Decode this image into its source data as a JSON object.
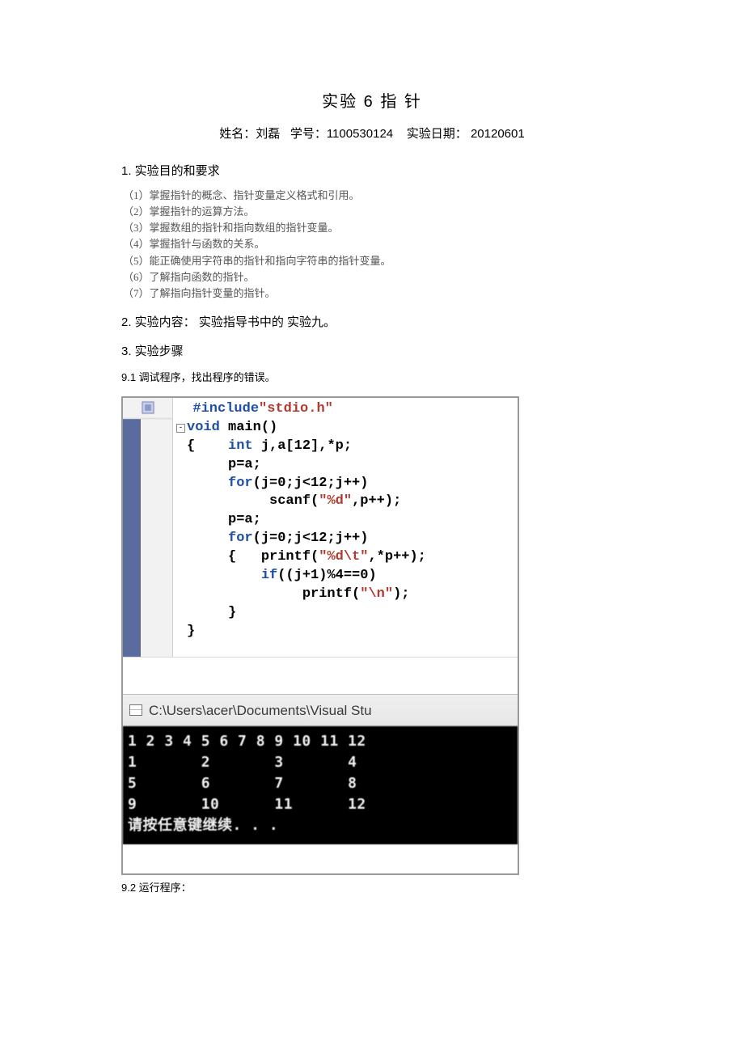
{
  "title": "实验 6   指  针",
  "student": {
    "name_label": "姓名：刘磊",
    "id_label": "学号：1100530124",
    "date_label": "实验日期： 20120601"
  },
  "sections": {
    "s1": "1.  实验目的和要求",
    "s2": "2.  实验内容：  实验指导书中的  实验九。",
    "s3": "3.  实验步骤"
  },
  "objectives": [
    "（1）掌握指针的概念、指针变量定义格式和引用。",
    "（2）掌握指针的运算方法。",
    "（3）掌握数组的指针和指向数组的指针变量。",
    "（4）掌握指针与函数的关系。",
    "（5）能正确使用字符串的指针和指向字符串的指针变量。",
    "（6）了解指向函数的指针。",
    "（7）了解指向指针变量的指针。"
  ],
  "substeps": {
    "s91": "9.1  调试程序，找出程序的错误。",
    "s92": "9.2  运行程序："
  },
  "code": {
    "l1": {
      "pre": "  #include",
      "str": "\"stdio.h\""
    },
    "l2": {
      "kw": "void",
      "rest": " main()"
    },
    "l3": {
      "brace": "{",
      "kw": "int",
      "rest": " j,a[12],*p;"
    },
    "l4": "p=a;",
    "l5": {
      "kw": "for",
      "rest": "(j=0;j<12;j++)"
    },
    "l6": {
      "fn": "scanf(",
      "str": "\"%d\"",
      "rest": ",p++);"
    },
    "l7": "p=a;",
    "l8": {
      "kw": "for",
      "rest": "(j=0;j<12;j++)"
    },
    "l9": {
      "brace": "{",
      "fn": "printf(",
      "str": "\"%d\\t\"",
      "rest": ",*p++);"
    },
    "l10": {
      "kw": "if",
      "rest": "((j+1)%4==0)"
    },
    "l11": {
      "fn": "printf(",
      "str": "\"\\n\"",
      "rest": ");"
    },
    "l12": "}",
    "l13": "}"
  },
  "console": {
    "title": " C:\\Users\\acer\\Documents\\Visual Stu",
    "rows": [
      "1 2 3 4 5 6 7 8 9 10 11 12",
      "1       2       3       4",
      "5       6       7       8",
      "9       10      11      12",
      "请按任意键继续. . ."
    ]
  }
}
